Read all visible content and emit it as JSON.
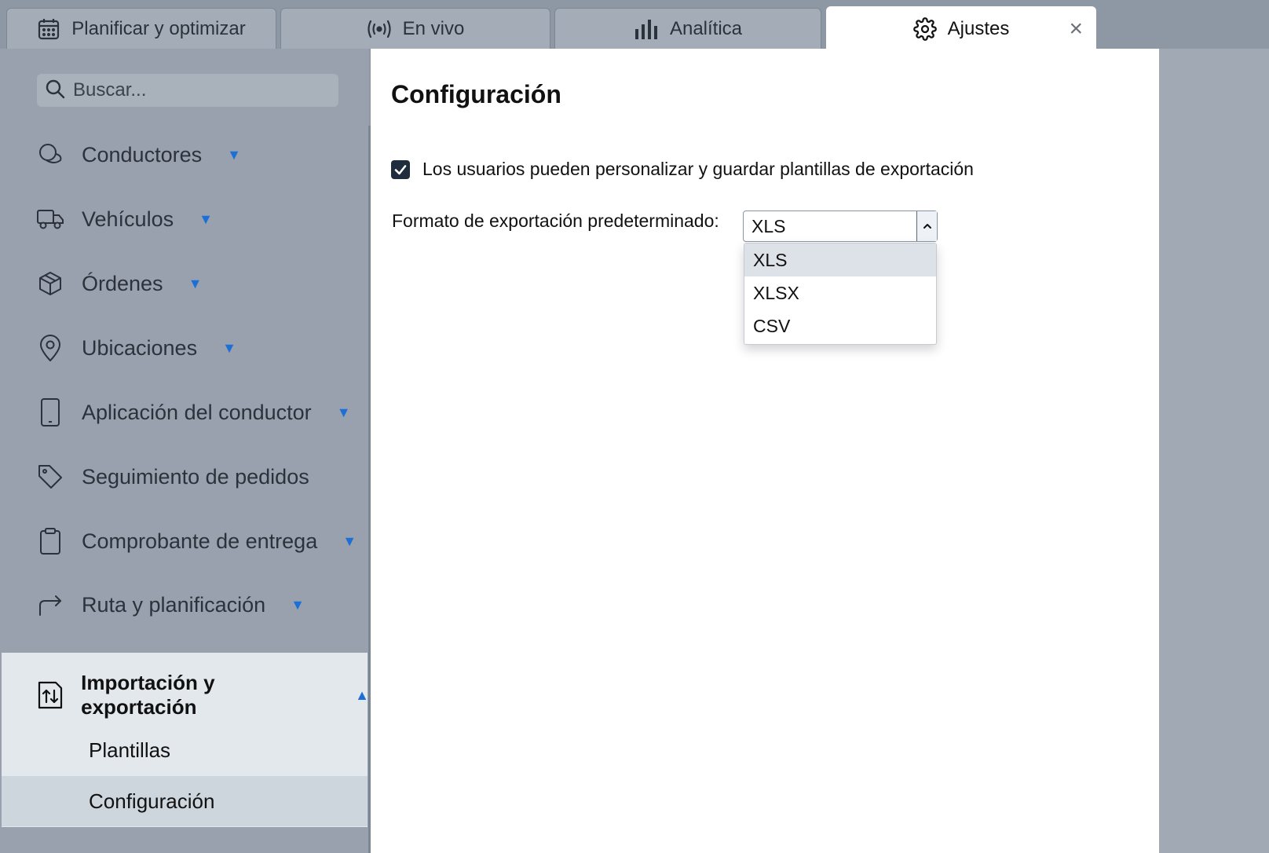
{
  "tabs": [
    {
      "label": "Planificar y optimizar",
      "icon": "calendar-icon"
    },
    {
      "label": "En vivo",
      "icon": "live-signal-icon"
    },
    {
      "label": "Analítica",
      "icon": "bar-chart-icon"
    },
    {
      "label": "Ajustes",
      "icon": "gear-icon",
      "active": true
    }
  ],
  "tab_close": "×",
  "sidebar": {
    "search_placeholder": "Buscar...",
    "items": [
      {
        "label": "Conductores",
        "icon": "drivers-icon",
        "expandable": true
      },
      {
        "label": "Vehículos",
        "icon": "truck-icon",
        "expandable": true
      },
      {
        "label": "Órdenes",
        "icon": "package-icon",
        "expandable": true
      },
      {
        "label": "Ubicaciones",
        "icon": "location-pin-icon",
        "expandable": true
      },
      {
        "label": "Aplicación del conductor",
        "icon": "phone-icon",
        "expandable": true
      },
      {
        "label": "Seguimiento de pedidos",
        "icon": "tag-icon",
        "expandable": false
      },
      {
        "label": "Comprobante de entrega",
        "icon": "clipboard-icon",
        "expandable": true
      },
      {
        "label": "Ruta y planificación",
        "icon": "route-arrow-icon",
        "expandable": true
      }
    ],
    "expanded": {
      "label": "Importación y exportación",
      "icon": "import-export-icon",
      "children": [
        {
          "label": "Plantillas"
        },
        {
          "label": "Configuración",
          "selected": true
        }
      ]
    }
  },
  "main": {
    "title": "Configuración",
    "checkbox_label": "Los usuarios pueden personalizar y guardar plantillas de exportación",
    "checkbox_checked": true,
    "format_label": "Formato de exportación predeterminado:",
    "format_value": "XLS",
    "format_options": [
      "XLS",
      "XLSX",
      "CSV"
    ]
  },
  "colors": {
    "accent": "#1d6fd8",
    "sidebar_bg": "#98a1ad",
    "selected_bg": "#cdd5dd"
  }
}
